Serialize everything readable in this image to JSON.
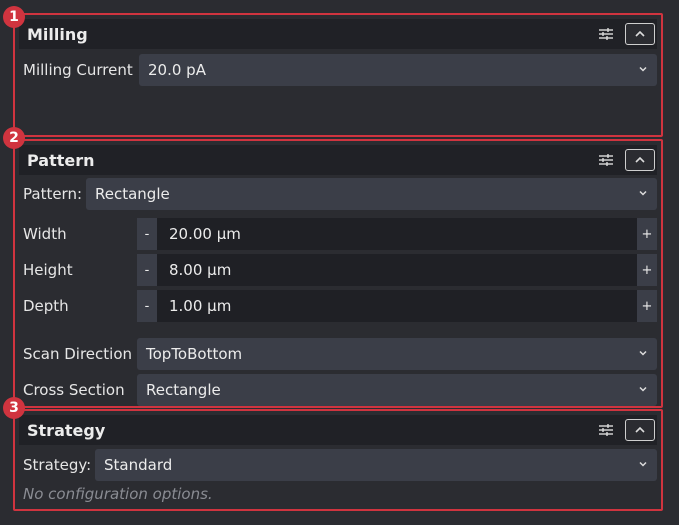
{
  "badges": [
    "1",
    "2",
    "3"
  ],
  "milling": {
    "title": "Milling",
    "current_label": "Milling Current",
    "current_value": "20.0 pA"
  },
  "pattern": {
    "title": "Pattern",
    "pattern_label": "Pattern:",
    "pattern_value": "Rectangle",
    "width_label": "Width",
    "width_value": "20.00 µm",
    "height_label": "Height",
    "height_value": "8.00 µm",
    "depth_label": "Depth",
    "depth_value": "1.00 µm",
    "scan_label": "Scan Direction",
    "scan_value": "TopToBottom",
    "cross_label": "Cross Section",
    "cross_value": "Rectangle",
    "minus": "-",
    "plus": "+"
  },
  "strategy": {
    "title": "Strategy",
    "strategy_label": "Strategy:",
    "strategy_value": "Standard",
    "note": "No configuration options."
  },
  "icons": {
    "settings": "tune-sliders-icon",
    "collapse": "chevron-up-icon",
    "dropdown": "chevron-down-icon"
  },
  "colors": {
    "highlight": "#d0343f",
    "background": "#2b2c31",
    "header": "#202126",
    "control": "#3b3e48",
    "field": "#1f2025"
  }
}
